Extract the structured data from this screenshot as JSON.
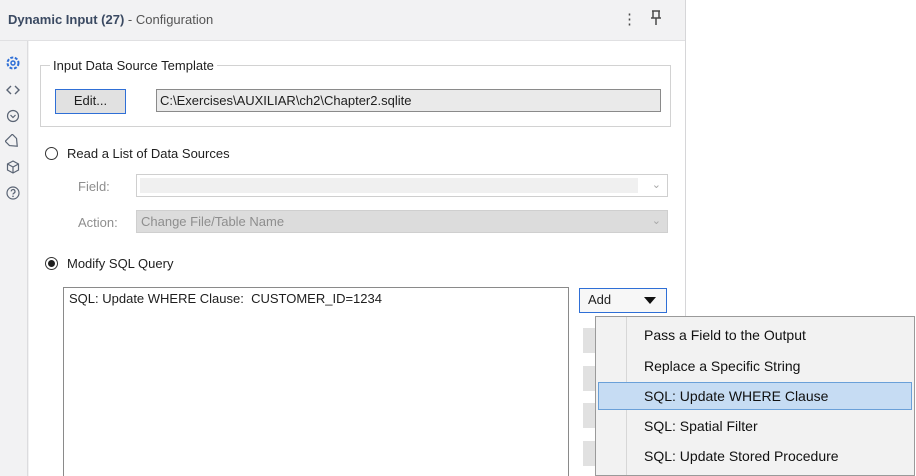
{
  "header": {
    "title": "Dynamic Input (27)",
    "subtitle": " - Configuration",
    "menu_icon": "vertical-ellipsis-icon",
    "pin_icon": "pin-icon"
  },
  "sidebar": {
    "icons": [
      "gear-icon",
      "code-icon",
      "layers-icon",
      "tag-icon",
      "cube-icon",
      "help-icon"
    ],
    "glyphs": [
      "⚙",
      "‹›",
      "⊛",
      "⬡",
      "◈",
      "?"
    ]
  },
  "template_group": {
    "legend": "Input Data Source Template",
    "edit_label": "Edit...",
    "path": "C:\\Exercises\\AUXILIAR\\ch2\\Chapter2.sqlite"
  },
  "read_list": {
    "label": "Read a List of Data Sources",
    "selected": false,
    "field_label": "Field:",
    "field_value": "",
    "action_label": "Action:",
    "action_value": "Change File/Table Name"
  },
  "modify_sql": {
    "label": "Modify SQL Query",
    "selected": true,
    "sql_text": "SQL: Update WHERE Clause:  CUSTOMER_ID=1234",
    "add_label": "Add"
  },
  "add_menu": {
    "items": [
      "Pass a Field to the Output",
      "Replace a Specific String",
      "SQL: Update WHERE Clause",
      "SQL: Spatial Filter",
      "SQL: Update Stored Procedure"
    ],
    "highlighted_index": 2
  },
  "colors": {
    "accent": "#2f6fd6",
    "highlight": "#c6dcf3",
    "panel_bg": "#f2f2f3"
  }
}
